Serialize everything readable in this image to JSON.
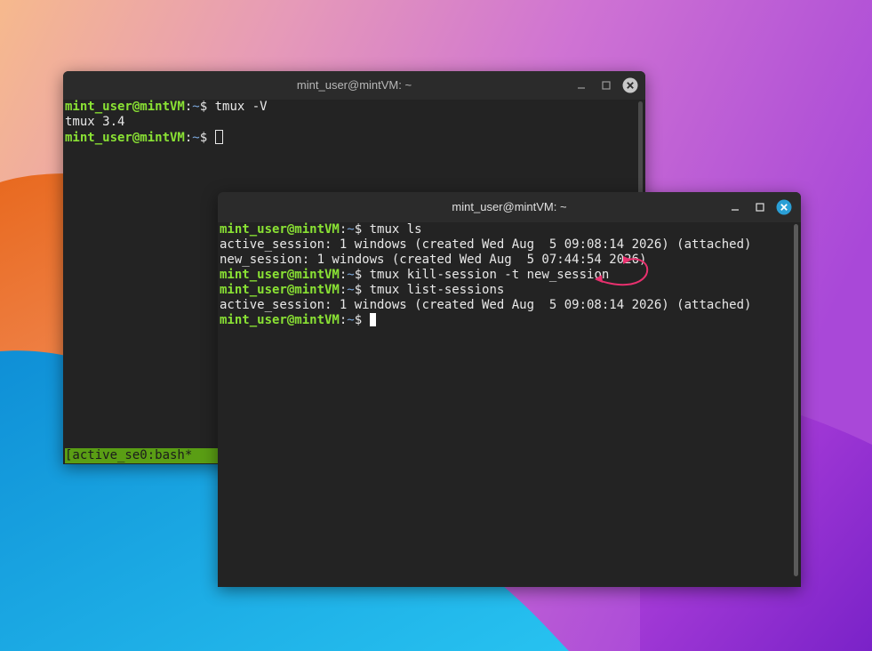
{
  "terminal1": {
    "title": "mint_user@mintVM: ~",
    "prompt": {
      "user": "mint_user@mintVM",
      "sep": ":",
      "path": "~",
      "symbol": "$ "
    },
    "lines": [
      {
        "type": "prompt",
        "command": "tmux -V"
      },
      {
        "type": "output",
        "text": "tmux 3.4"
      },
      {
        "type": "prompt",
        "command": ""
      }
    ],
    "status_bar": "[active_se0:bash*"
  },
  "terminal2": {
    "title": "mint_user@mintVM: ~",
    "prompt": {
      "user": "mint_user@mintVM",
      "sep": ":",
      "path": "~",
      "symbol": "$ "
    },
    "lines": [
      {
        "type": "prompt",
        "command": "tmux ls"
      },
      {
        "type": "output",
        "text": "active_session: 1 windows (created Wed Aug  5 09:08:14 2026) (attached)"
      },
      {
        "type": "output",
        "text": "new_session: 1 windows (created Wed Aug  5 07:44:54 2026)"
      },
      {
        "type": "prompt",
        "command": "tmux kill-session -t new_session"
      },
      {
        "type": "prompt",
        "command": "tmux list-sessions"
      },
      {
        "type": "output",
        "text": "active_session: 1 windows (created Wed Aug  5 09:08:14 2026) (attached)"
      },
      {
        "type": "prompt",
        "command": ""
      }
    ]
  },
  "colors": {
    "prompt_user": "#8ae234",
    "prompt_path": "#7aa6da",
    "status_bar": "#5a9e14",
    "close_button_active": "#2a9fd6",
    "annotation_arrow": "#e8306e"
  },
  "icons": {
    "minimize": "minimize-icon",
    "maximize": "maximize-icon",
    "close": "close-icon"
  }
}
